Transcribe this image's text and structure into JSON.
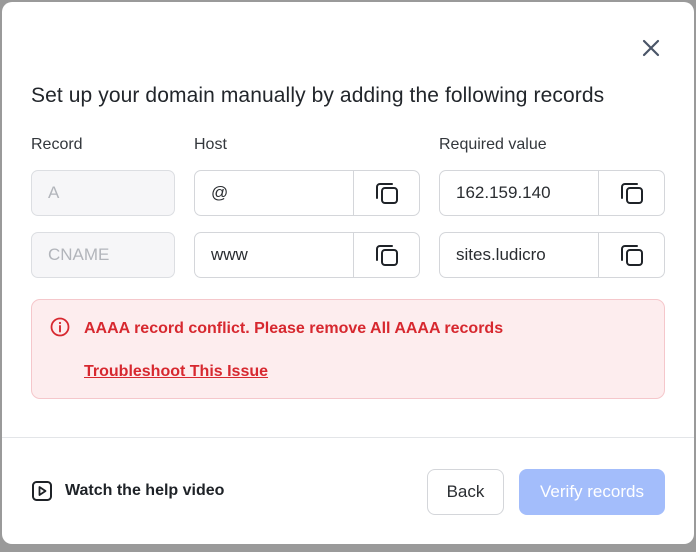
{
  "dialog": {
    "title": "Set up your domain manually by adding the following records",
    "close_icon": "close-icon"
  },
  "columns": {
    "record": "Record",
    "host": "Host",
    "required_value": "Required value"
  },
  "records": [
    {
      "type": "A",
      "host": "@",
      "value": "162.159.140"
    },
    {
      "type": "CNAME",
      "host": "www",
      "value": "sites.ludicro"
    }
  ],
  "alert": {
    "icon": "info-circle-icon",
    "message": "AAAA record conflict. Please remove All AAAA records",
    "link": "Troubleshoot This Issue",
    "color": "#d7282f"
  },
  "footer": {
    "help_icon": "play-square-icon",
    "help_label": "Watch the help video",
    "back_label": "Back",
    "verify_label": "Verify records",
    "verify_color": "#a3bdfb"
  }
}
